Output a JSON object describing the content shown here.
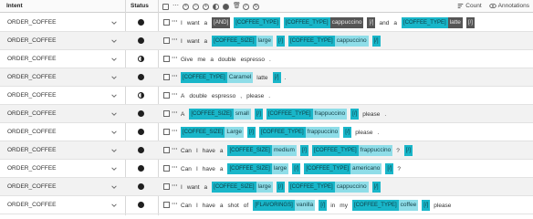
{
  "header": {
    "intent_label": "Intent",
    "status_label": "Status",
    "count_label": "Count",
    "annotations_label": "Annotations"
  },
  "toolbar": {
    "icons": [
      "checkbox-icon",
      "more-icon",
      "circle-empty-icon",
      "circle-x-icon",
      "circle-plus-icon",
      "circle-half-icon",
      "circle-filled-icon",
      "trash-icon",
      "check-icon",
      "refresh-icon"
    ]
  },
  "rows": [
    {
      "intent": "ORDER_COFFEE",
      "status": "full",
      "tokens": [
        {
          "t": "I"
        },
        {
          "t": "want"
        },
        {
          "t": "a"
        },
        {
          "e": "[AND]",
          "dark": true
        },
        {
          "e": "[COFFEE_TYPE]",
          "dark": true,
          "hl": true
        },
        {
          "e": "[COFFEE_TYPE]",
          "v": "cappuccino",
          "dark": true,
          "hl": true
        },
        {
          "e": "[/]",
          "dark": true
        },
        {
          "t": "and"
        },
        {
          "t": "a"
        },
        {
          "e": "[COFFEE_TYPE]",
          "v": "latte",
          "dark": true,
          "hl": true
        },
        {
          "e": "[/]",
          "dark": true
        }
      ]
    },
    {
      "intent": "ORDER_COFFEE",
      "status": "full",
      "tokens": [
        {
          "t": "I"
        },
        {
          "t": "want"
        },
        {
          "t": "a"
        },
        {
          "e": "[COFFEE_SIZE]",
          "v": "large"
        },
        {
          "e": "[/]"
        },
        {
          "e": "[COFFEE_TYPE]",
          "v": "cappuccino"
        },
        {
          "e": "[/]"
        }
      ]
    },
    {
      "intent": "ORDER_COFFEE",
      "status": "half",
      "tokens": [
        {
          "t": "Give"
        },
        {
          "t": "me"
        },
        {
          "t": "a"
        },
        {
          "t": "double"
        },
        {
          "t": "espresso"
        },
        {
          "t": "."
        }
      ]
    },
    {
      "intent": "ORDER_COFFEE",
      "status": "full",
      "tokens": [
        {
          "e": "[COFFEE_TYPE]",
          "v": "Caramel"
        },
        {
          "t": "latte"
        },
        {
          "e": "[/]"
        },
        {
          "t": "."
        }
      ]
    },
    {
      "intent": "ORDER_COFFEE",
      "status": "half",
      "tokens": [
        {
          "t": "A"
        },
        {
          "t": "double"
        },
        {
          "t": "espresso"
        },
        {
          "t": ","
        },
        {
          "t": "please"
        },
        {
          "t": "."
        }
      ]
    },
    {
      "intent": "ORDER_COFFEE",
      "status": "full",
      "tokens": [
        {
          "t": "A"
        },
        {
          "e": "[COFFEE_SIZE]",
          "v": "small"
        },
        {
          "e": "[/]"
        },
        {
          "e": "[COFFEE_TYPE]",
          "v": "frappuccino"
        },
        {
          "e": "[/]"
        },
        {
          "t": "please"
        },
        {
          "t": "."
        }
      ]
    },
    {
      "intent": "ORDER_COFFEE",
      "status": "full",
      "tokens": [
        {
          "e": "[COFFEE_SIZE]",
          "v": "Large"
        },
        {
          "e": "[/]"
        },
        {
          "e": "[COFFEE_TYPE]",
          "v": "frappuccino"
        },
        {
          "e": "[/]"
        },
        {
          "t": "please"
        },
        {
          "t": "."
        }
      ]
    },
    {
      "intent": "ORDER_COFFEE",
      "status": "full",
      "tokens": [
        {
          "t": "Can"
        },
        {
          "t": "I"
        },
        {
          "t": "have"
        },
        {
          "t": "a"
        },
        {
          "e": "[COFFEE_SIZE]",
          "v": "medium"
        },
        {
          "e": "[/]"
        },
        {
          "e": "[COFFEE_TYPE]",
          "v": "frappuccino"
        },
        {
          "t": "?"
        },
        {
          "e": "[/]"
        }
      ]
    },
    {
      "intent": "ORDER_COFFEE",
      "status": "full",
      "tokens": [
        {
          "t": "Can"
        },
        {
          "t": "I"
        },
        {
          "t": "have"
        },
        {
          "t": "a"
        },
        {
          "e": "[COFFEE_SIZE]",
          "v": "large"
        },
        {
          "e": "[/]"
        },
        {
          "e": "[COFFEE_TYPE]",
          "v": "americano"
        },
        {
          "e": "[/]"
        },
        {
          "t": "?"
        }
      ]
    },
    {
      "intent": "ORDER_COFFEE",
      "status": "full",
      "tokens": [
        {
          "t": "I"
        },
        {
          "t": "want"
        },
        {
          "t": "a"
        },
        {
          "e": "[COFFEE_SIZE]",
          "v": "large"
        },
        {
          "e": "[/]"
        },
        {
          "e": "[COFFEE_TYPE]",
          "v": "cappuccino"
        },
        {
          "e": "[/]"
        }
      ]
    },
    {
      "intent": "ORDER_COFFEE",
      "status": "full",
      "tokens": [
        {
          "t": "Can"
        },
        {
          "t": "I"
        },
        {
          "t": "have"
        },
        {
          "t": "a"
        },
        {
          "t": "shot"
        },
        {
          "t": "of"
        },
        {
          "e": "[FLAVORINGS]",
          "v": "vanilla"
        },
        {
          "e": "[/]"
        },
        {
          "t": "in"
        },
        {
          "t": "my"
        },
        {
          "e": "[COFFEE_TYPE]",
          "v": "coffee"
        },
        {
          "e": "[/]"
        },
        {
          "t": "please"
        }
      ]
    }
  ]
}
